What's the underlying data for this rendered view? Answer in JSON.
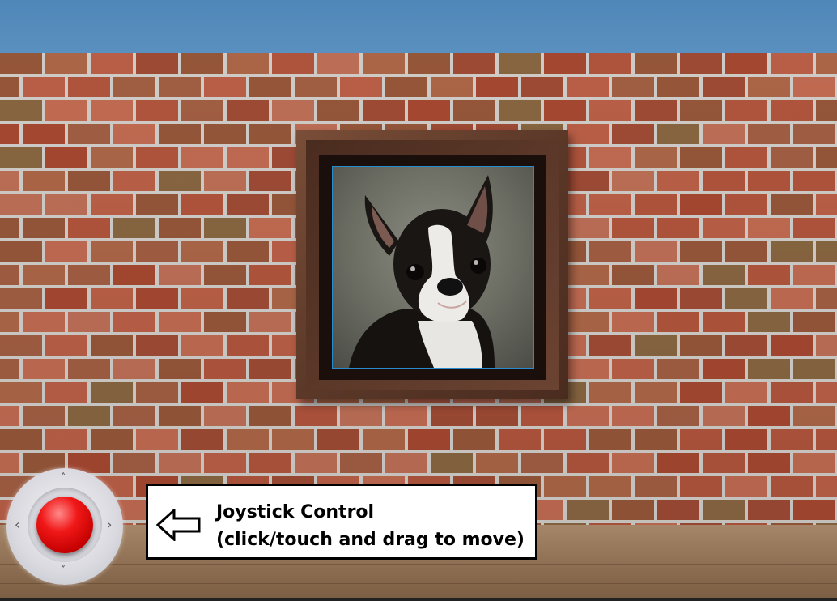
{
  "scene": {
    "sky_color": "#5289bb",
    "wall_texture": "red-brick",
    "floor_texture": "wood",
    "painting": {
      "subject": "boston-terrier-portrait",
      "frame_color": "#5b3828",
      "border_color": "#2a8ad0"
    }
  },
  "joystick": {
    "knob_color": "#e00000",
    "arrows": {
      "up": "˄",
      "down": "˅",
      "left": "‹",
      "right": "›"
    }
  },
  "tooltip": {
    "line1": "Joystick Control",
    "line2": "(click/touch and drag to move)",
    "icon": "left-arrow-icon"
  }
}
